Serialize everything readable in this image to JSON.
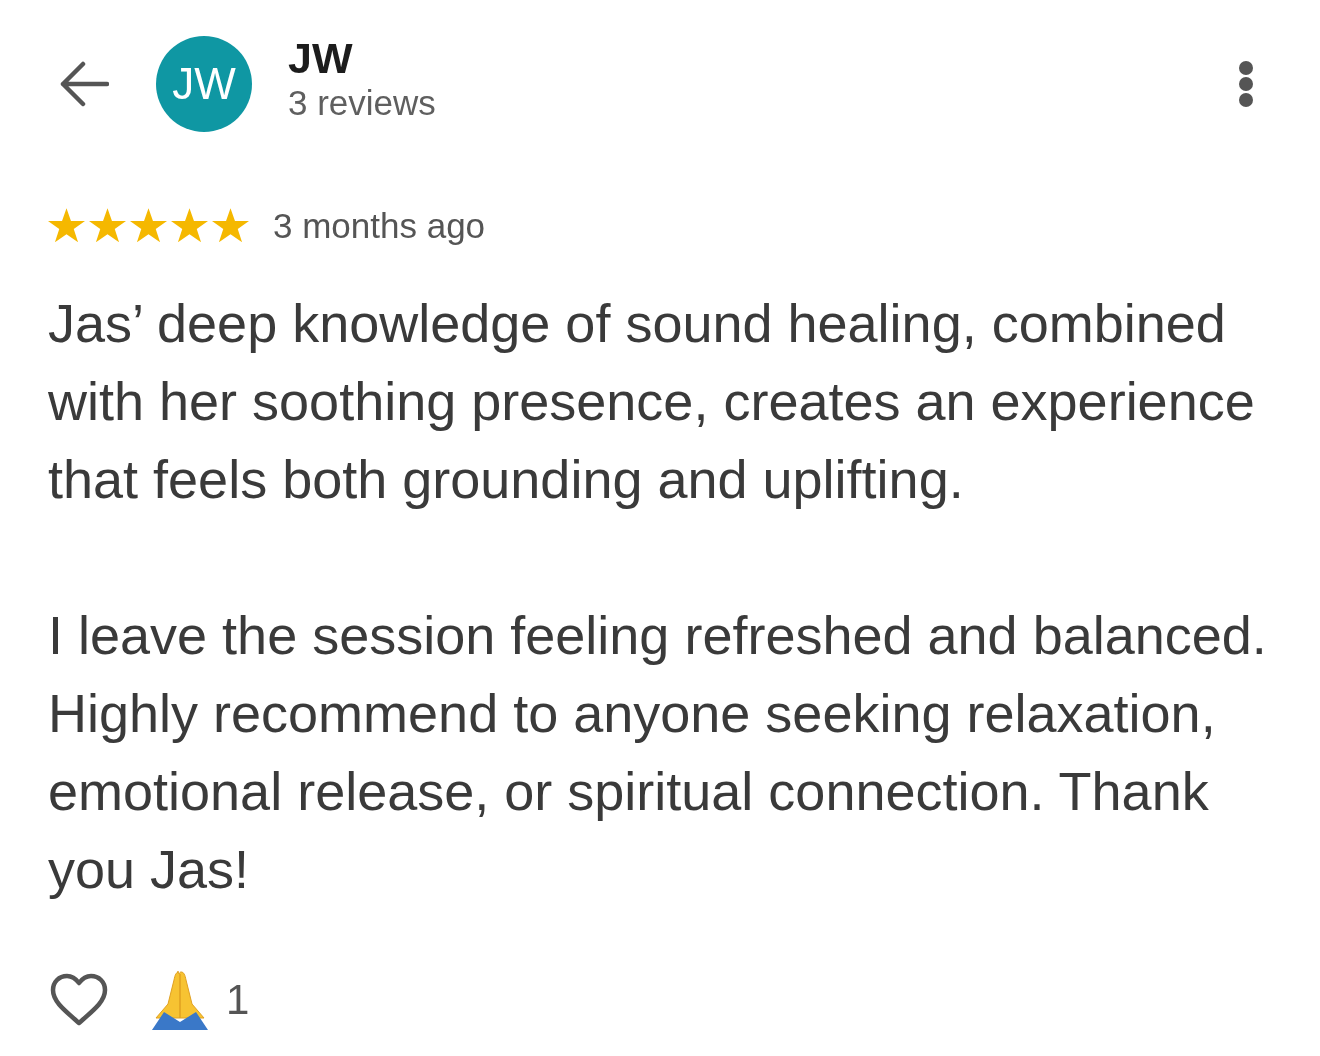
{
  "header": {
    "avatar_initials": "JW",
    "name": "JW",
    "subtitle": "3 reviews"
  },
  "review": {
    "stars": 5,
    "time": "3 months ago",
    "paragraphs": [
      "Jas’ deep knowledge of sound healing, combined with her soothing presence, creates an experience that feels both grounding and uplifting.",
      "I leave the session feeling refreshed and balanced. Highly recommend to anyone seeking relaxation, emotional release, or spiritual connection. Thank you Jas!"
    ]
  },
  "reactions": {
    "liked": false,
    "count": "1"
  }
}
